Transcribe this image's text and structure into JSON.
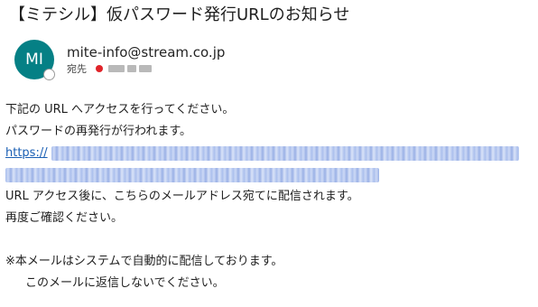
{
  "email": {
    "subject": "【ミテシル】仮パスワード発行URLのお知らせ",
    "avatar_initials": "MI",
    "sender": "mite-info@stream.co.jp",
    "to_label": "宛先"
  },
  "body": {
    "line1": "下記の URL へアクセスを行ってください。",
    "line2": "パスワードの再発行が行われます。",
    "link_prefix": "https://",
    "line3": "URL アクセス後に、こちらのメールアドレス宛てに配信されます。",
    "line4": "再度ご確認ください。",
    "note1": "※本メールはシステムで自動的に配信しております。",
    "note2": "このメールに返信しないでください。"
  },
  "colors": {
    "avatar": "#058085",
    "link": "#1a5fb4",
    "recipient_status": "#e0242a"
  }
}
